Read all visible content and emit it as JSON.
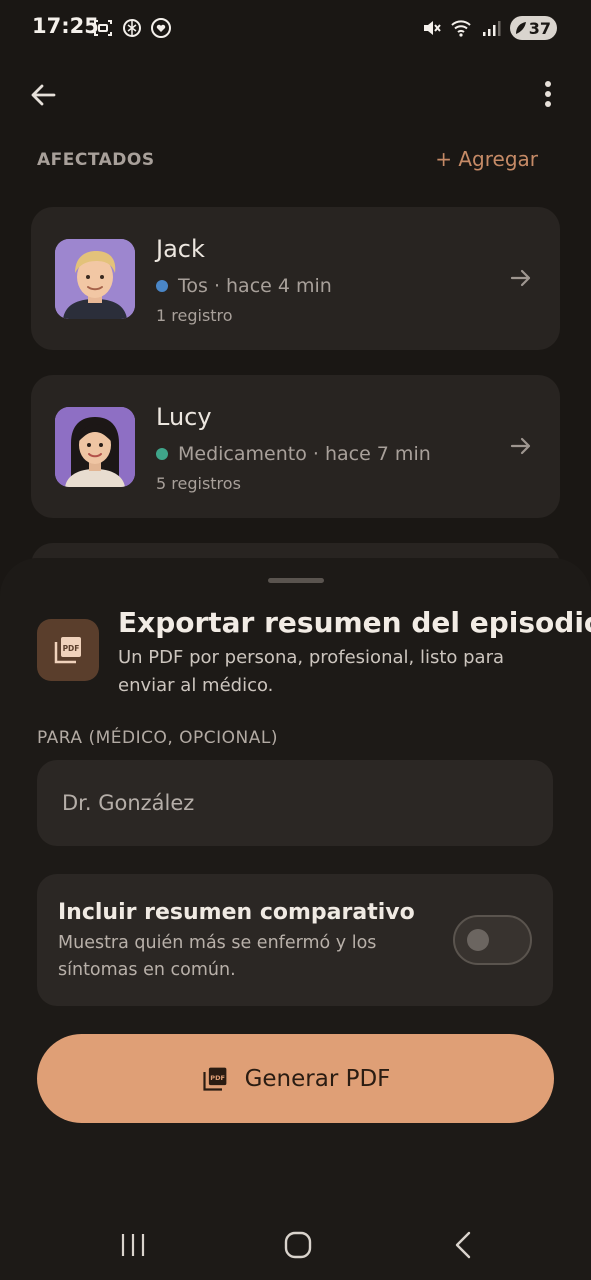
{
  "status_bar": {
    "time": "17:25",
    "battery_level": "37",
    "left_icons": [
      "screenshot-icon",
      "chatgpt-icon",
      "health-icon"
    ],
    "right_icons": [
      "mute-icon",
      "wifi-icon",
      "signal-icon"
    ]
  },
  "toolbar": {
    "back_icon": "arrow-left-icon",
    "more_icon": "more-vertical-icon"
  },
  "affected": {
    "section_title": "AFECTADOS",
    "add_label": "+ Agregar",
    "people": [
      {
        "name": "Jack",
        "status_text": "Tos · hace 4 min",
        "status_color": "#4a86c7",
        "count_text": "1 registro"
      },
      {
        "name": "Lucy",
        "status_text": "Medicamento · hace 7 min",
        "status_color": "#3fa58a",
        "count_text": "5 registros"
      }
    ]
  },
  "export_sheet": {
    "title": "Exportar resumen del episodio",
    "subtitle": "Un PDF por persona, profesional, listo para enviar al médico.",
    "recipient_label": "PARA (MÉDICO, OPCIONAL)",
    "recipient_value": "Dr. González",
    "comparative": {
      "title": "Incluir resumen comparativo",
      "description": "Muestra quién más se enfermó y los síntomas en común.",
      "enabled": false
    },
    "generate_label": "Generar PDF",
    "accent_color": "#df9f76"
  },
  "nav_bar": {
    "icons": [
      "recents-icon",
      "home-icon",
      "back-icon"
    ]
  }
}
